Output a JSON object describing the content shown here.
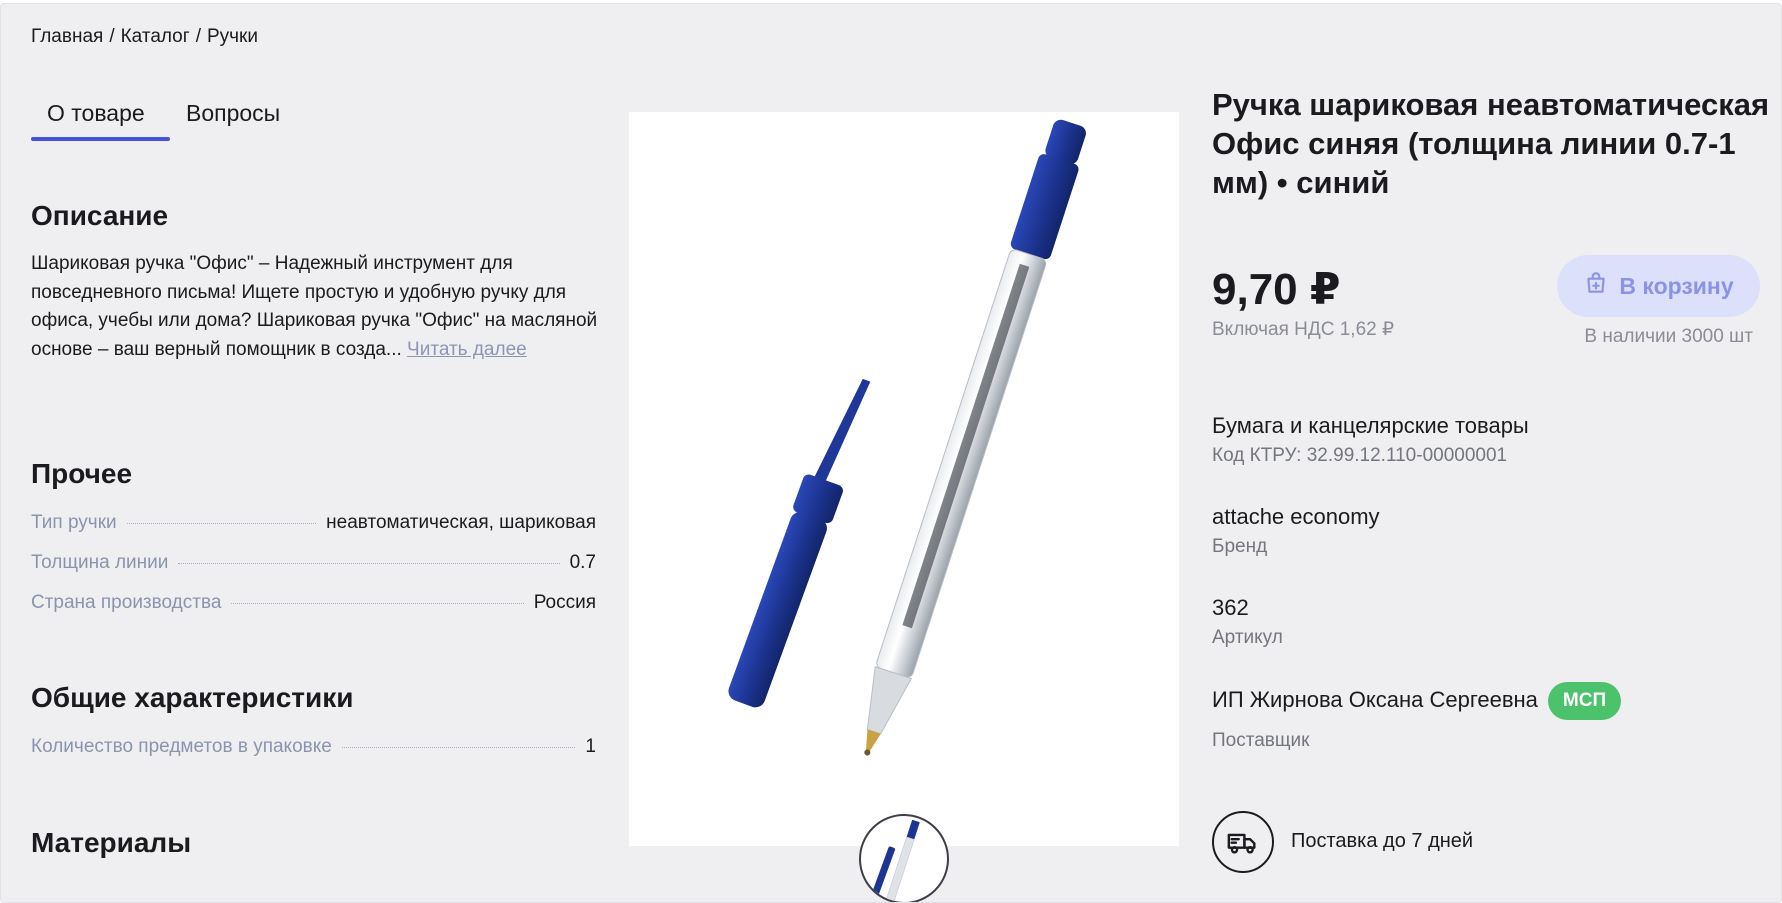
{
  "breadcrumb": {
    "home": "Главная",
    "catalog": "Каталог",
    "category": "Ручки",
    "separator": "/"
  },
  "tabs": [
    {
      "label": "О товаре"
    },
    {
      "label": "Вопросы"
    }
  ],
  "description": {
    "heading": "Описание",
    "text": "Шариковая ручка \"Офис\" – Надежный инструмент для повседневного письма! Ищете простую и удобную ручку для офиса, учебы или дома? Шариковая ручка \"Офис\" на масляной основе – ваш верный помощник в созда...",
    "read_more": "Читать далее"
  },
  "other": {
    "heading": "Прочее",
    "rows": [
      {
        "key": "Тип ручки",
        "value": "неавтоматическая, шариковая"
      },
      {
        "key": "Толщина линии",
        "value": "0.7"
      },
      {
        "key": "Страна производства",
        "value": "Россия"
      }
    ]
  },
  "general": {
    "heading": "Общие характеристики",
    "rows": [
      {
        "key": "Количество предметов в упаковке",
        "value": "1"
      }
    ]
  },
  "materials": {
    "heading": "Материалы"
  },
  "product": {
    "title": "Ручка шариковая неавтоматическая Офис синяя (толщина линии 0.7-1 мм) • синий",
    "price": "9,70 ₽",
    "vat": "Включая НДС 1,62 ₽",
    "cart_label": "В корзину",
    "stock": "В наличии 3000 шт",
    "category": "Бумага и канцелярские товары",
    "ktru": "Код КТРУ: 32.99.12.110-00000001",
    "brand": "attache economy",
    "brand_label": "Бренд",
    "article": "362",
    "article_label": "Артикул",
    "supplier": "ИП Жирнова Оксана Сергеевна",
    "supplier_badge": "МСП",
    "supplier_label": "Поставщик",
    "delivery": "Поставка до 7 дней"
  },
  "colors": {
    "accent": "#4553d7",
    "pen_blue": "#1f3a9e",
    "badge_green": "#4cc26c",
    "cart_bg": "#dde0fb"
  },
  "icons": {
    "cart": "shopping-bag-icon",
    "delivery": "truck-icon"
  }
}
